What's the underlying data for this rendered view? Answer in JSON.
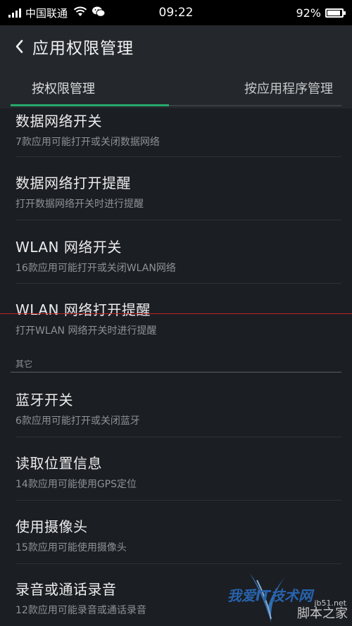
{
  "status_bar": {
    "carrier": "中国联通",
    "time": "09:22",
    "battery_percent": "92%",
    "battery_level": 0.92,
    "signal_bars": 4
  },
  "header": {
    "title": "应用权限管理"
  },
  "tabs": [
    {
      "label": "按权限管理",
      "active": true
    },
    {
      "label": "按应用程序管理",
      "active": false
    }
  ],
  "items": [
    {
      "title": "数据网络开关",
      "subtitle": "7款应用可能打开或关闭数据网络"
    },
    {
      "title": "数据网络打开提醒",
      "subtitle": "打开数据网络开关时进行提醒"
    },
    {
      "title": "WLAN 网络开关",
      "subtitle": "16款应用可能打开或关闭WLAN网络"
    },
    {
      "title": "WLAN 网络打开提醒",
      "subtitle": "打开WLAN 网络开关时进行提醒"
    }
  ],
  "section": {
    "label": "其它"
  },
  "other_items": [
    {
      "title": "蓝牙开关",
      "subtitle": "6款应用可能打开或关闭蓝牙"
    },
    {
      "title": "读取位置信息",
      "subtitle": "14款应用可能使用GPS定位"
    },
    {
      "title": "使用摄像头",
      "subtitle": "15款应用可能使用摄像头"
    },
    {
      "title": "录音或通话录音",
      "subtitle": "12款应用可能录音或通话录音"
    }
  ],
  "watermark": {
    "line1": "我爱IT技术网",
    "line2": "脚本之家",
    "line3": "jb51.net"
  },
  "colors": {
    "accent": "#26a86a",
    "background": "#1b1e23",
    "header": "#24282d"
  },
  "icons": {
    "back": "chevron-left-icon",
    "wifi": "wifi-icon",
    "chat": "wechat-icon",
    "battery": "battery-icon"
  }
}
